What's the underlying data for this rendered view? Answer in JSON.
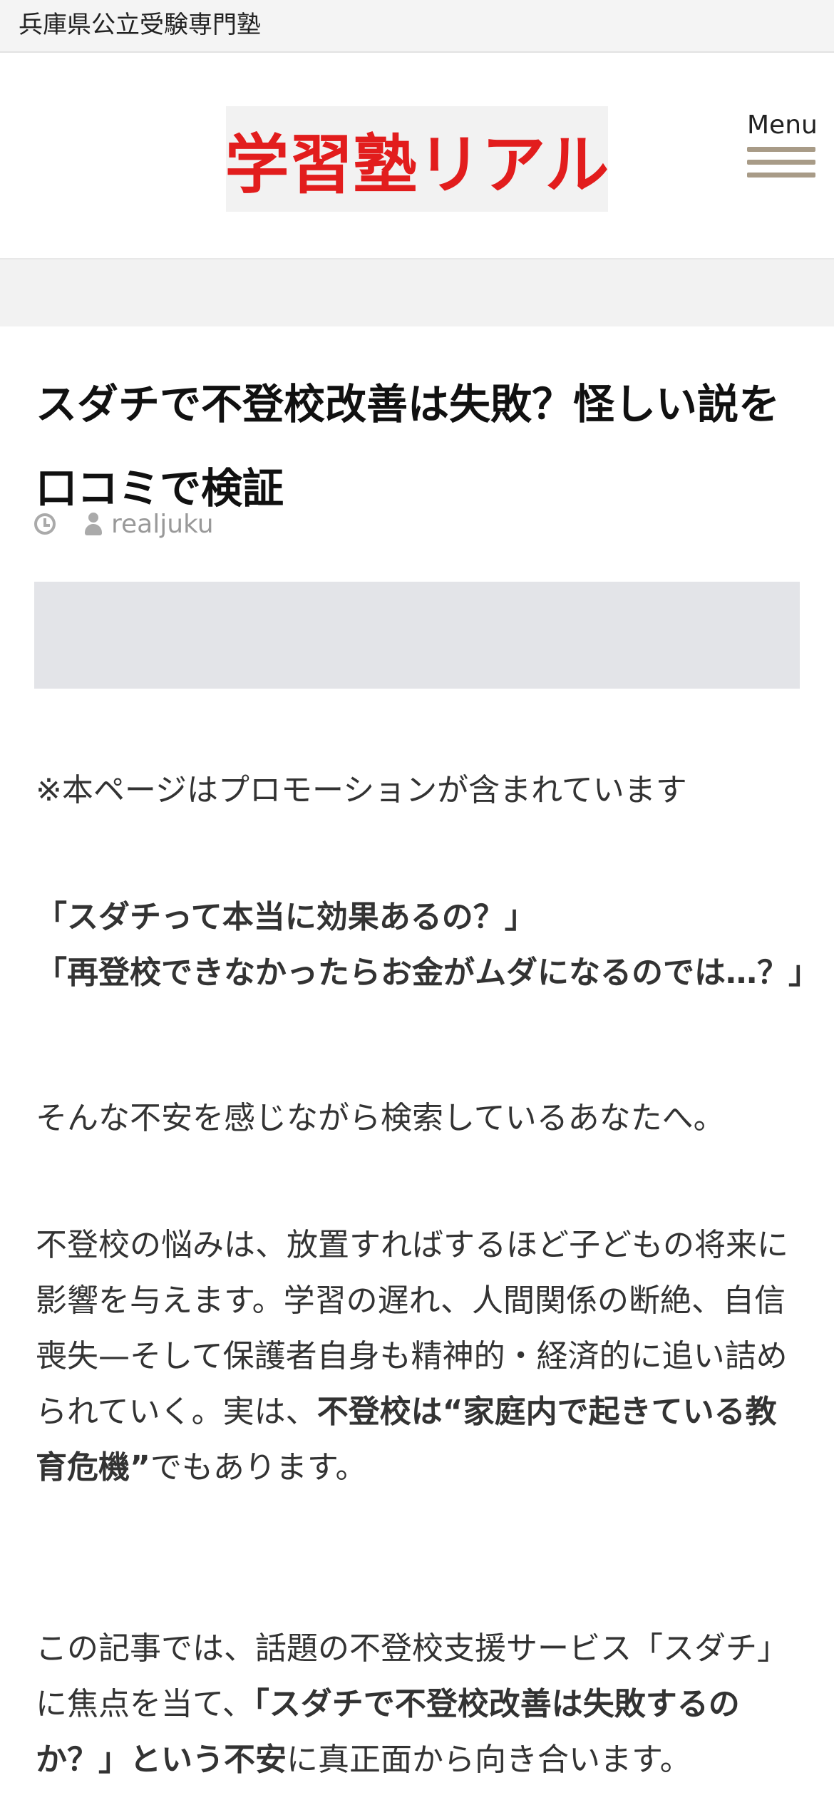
{
  "topbar": {
    "tagline": "兵庫県公立受験専門塾"
  },
  "header": {
    "logo_text": "学習塾リアル",
    "menu_label": "Menu"
  },
  "article": {
    "title": "スダチで不登校改善は失敗？怪しい説を口コミで検証",
    "author": "realjuku",
    "promo_notice": "※本ページはプロモーションが含まれています",
    "quote_line1": "「スダチって本当に効果あるの？」",
    "quote_line2": "「再登校できなかったらお金がムダになるのでは…？」",
    "para_lead": "そんな不安を感じながら検索しているあなたへ。",
    "para2_text": "不登校の悩みは、放置すればするほど子どもの将来に影響を与えます。学習の遅れ、人間関係の断絶、自信喪失—そして保護者自身も精神的・経済的に追い詰められていく。実は、",
    "para2_bold": "不登校は“家庭内で起きている教育危機”",
    "para2_tail": "でもあります。",
    "para3_text": "この記事では、話題の不登校支援サービス「スダチ」に焦点を当て、",
    "para3_bold": "「スダチで不登校改善は失敗するのか？」という不安",
    "para3_tail": "に真正面から向き合います。"
  },
  "colors": {
    "logo_red": "#e21d1d",
    "menu_bar": "#a89b87",
    "ad_placeholder": "#e3e4e8"
  }
}
